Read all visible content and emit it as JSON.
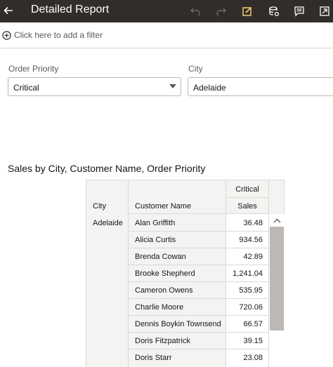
{
  "header": {
    "title": "Detailed Report",
    "icons": [
      "back-arrow-icon",
      "undo-icon",
      "redo-icon",
      "edit-icon",
      "data-icon",
      "comment-icon",
      "export-icon"
    ]
  },
  "filterbar": {
    "add_filter_label": "Click here to add a filter"
  },
  "prompts": [
    {
      "label": "Order Priority",
      "value": "Critical"
    },
    {
      "label": "City",
      "value": "Adelaide"
    }
  ],
  "viz": {
    "title": "Sales by City, Customer Name, Order Priority",
    "header_city": "City",
    "header_customer": "Customer Name",
    "header_priority": "Critical",
    "header_sales": "Sales",
    "city_value": "Adelaide",
    "rows": [
      {
        "name": "Alan Griffith",
        "sales": "36.48"
      },
      {
        "name": "Alicia Curtis",
        "sales": "934.56"
      },
      {
        "name": "Brenda Cowan",
        "sales": "42.89"
      },
      {
        "name": "Brooke Shepherd",
        "sales": "1,241.04"
      },
      {
        "name": "Cameron Owens",
        "sales": "535.95"
      },
      {
        "name": "Charlie Moore",
        "sales": "720.06"
      },
      {
        "name": "Dennis Boykin Townsend",
        "sales": "66.57"
      },
      {
        "name": "Doris Fitzpatrick",
        "sales": "39.15"
      },
      {
        "name": "Doris Starr",
        "sales": "23.08"
      }
    ]
  },
  "colors": {
    "topbar": "#312d2a",
    "accent_edit": "#f0cc71"
  }
}
